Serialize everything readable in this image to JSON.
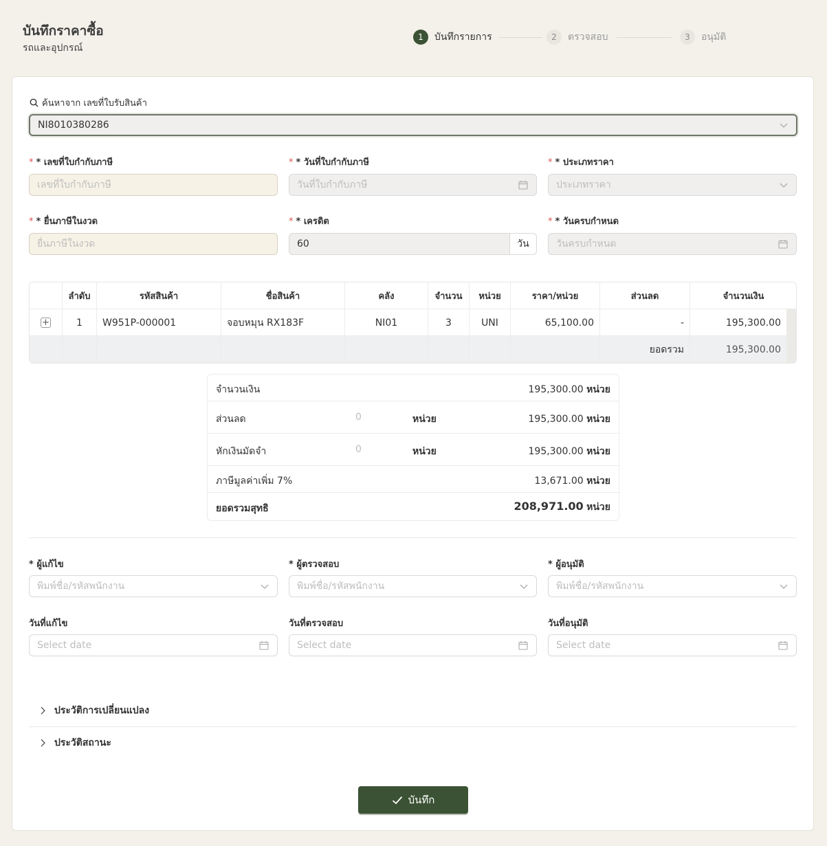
{
  "header": {
    "title": "บันทึกราคาซื้อ",
    "subtitle": "รถและอุปกรณ์"
  },
  "steps": [
    {
      "number": "1",
      "label": "บันทึกรายการ",
      "active": true
    },
    {
      "number": "2",
      "label": "ตรวจสอบ",
      "active": false
    },
    {
      "number": "3",
      "label": "อนุมัติ",
      "active": false
    }
  ],
  "search": {
    "label": "ค้นหาจาก เลขที่ใบรับสินค้า",
    "value": "NI8010380286"
  },
  "fields": {
    "tax_invoice_no": {
      "label": "* เลขที่ใบกำกับภาษี",
      "placeholder": "เลขที่ใบกำกับภาษี"
    },
    "tax_invoice_date": {
      "label": "* วันที่ใบกำกับภาษี",
      "placeholder": "วันที่ใบกำกับภาษี"
    },
    "price_type": {
      "label": "* ประเภทราคา",
      "placeholder": "ประเภทราคา"
    },
    "tax_period": {
      "label": "* ยื่นภาษีในงวด",
      "placeholder": "ยื่นภาษีในงวด"
    },
    "credit": {
      "label": "* เครดิต",
      "value": "60",
      "suffix": "วัน"
    },
    "due_date": {
      "label": "* วันครบกำหนด",
      "placeholder": "วันครบกำหนด"
    }
  },
  "table": {
    "headers": [
      "",
      "ลำดับ",
      "รหัสสินค้า",
      "ชื่อสินค้า",
      "คลัง",
      "จำนวน",
      "หน่วย",
      "ราคา/หน่วย",
      "ส่วนลด",
      "จำนวนเงิน"
    ],
    "rows": [
      {
        "expand": "+",
        "seq": "1",
        "code": "W951P-000001",
        "name": "จอบหมุน RX183F",
        "warehouse": "NI01",
        "qty": "3",
        "unit": "UNI",
        "price": "65,100.00",
        "discount": "-",
        "amount": "195,300.00"
      }
    ],
    "footer": {
      "label": "ยอดรวม",
      "total": "195,300.00"
    }
  },
  "summary": {
    "amount": {
      "label": "จำนวนเงิน",
      "value": "195,300.00",
      "unit": "หน่วย"
    },
    "discount": {
      "label": "ส่วนลด",
      "input": "0",
      "input_unit": "หน่วย",
      "value": "195,300.00",
      "unit": "หน่วย"
    },
    "deposit": {
      "label": "หักเงินมัดจำ",
      "input": "0",
      "input_unit": "หน่วย",
      "value": "195,300.00",
      "unit": "หน่วย"
    },
    "vat": {
      "label": "ภาษีมูลค่าเพิ่ม 7%",
      "value": "13,671.00",
      "unit": "หน่วย"
    },
    "net": {
      "label": "ยอดรวมสุทธิ",
      "value": "208,971.00",
      "unit": "หน่วย"
    }
  },
  "people": {
    "editor": {
      "label": "* ผู้แก้ไข",
      "placeholder": "พิมพ์ชื่อ/รหัสพนักงาน"
    },
    "checker": {
      "label": "* ผู้ตรวจสอบ",
      "placeholder": "พิมพ์ชื่อ/รหัสพนักงาน"
    },
    "approver": {
      "label": "* ผู้อนุมัติ",
      "placeholder": "พิมพ์ชื่อ/รหัสพนักงาน"
    },
    "edit_date": {
      "label": "วันที่แก้ไข",
      "placeholder": "Select date"
    },
    "check_date": {
      "label": "วันที่ตรวจสอบ",
      "placeholder": "Select date"
    },
    "approve_date": {
      "label": "วันที่อนุมัติ",
      "placeholder": "Select date"
    }
  },
  "history": {
    "changes": "ประวัติการเปลี่ยนแปลง",
    "status": "ประวัติสถานะ"
  },
  "actions": {
    "save": "บันทึก"
  },
  "colors": {
    "primary": "#3c5234",
    "background": "#f3f1ea",
    "required": "#d9534f"
  }
}
